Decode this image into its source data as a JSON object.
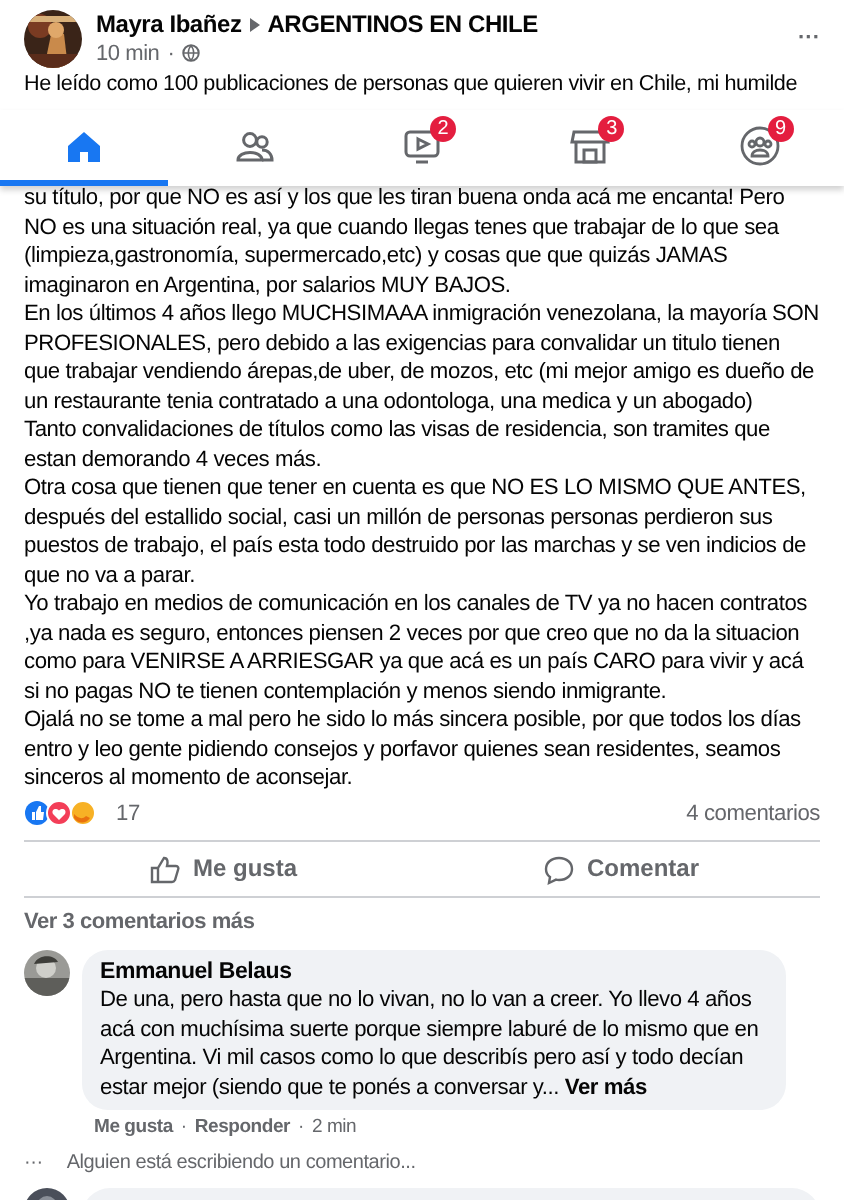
{
  "post": {
    "author": "Mayra Ibañez",
    "group": "ARGENTINOS EN CHILE",
    "time": "10 min",
    "time_separator": "·",
    "more": "···",
    "first_line": "He leído como 100 publicaciones de personas que quieren vivir en Chile, mi humilde",
    "paragraphs": [
      "su título, por que NO es así y los que les tiran buena onda acá me encanta!  Pero NO es una situación real, ya que cuando llegas tenes que trabajar de lo que sea (limpieza,gastronomía, supermercado,etc) y cosas que que quizás JAMAS imaginaron en Argentina, por salarios MUY BAJOS.",
      "En los últimos 4 años llego MUCHSIMAAA inmigración  venezolana, la mayoría SON PROFESIONALES, pero debido a las exigencias para convalidar un titulo tienen que trabajar vendiendo árepas,de uber, de mozos, etc (mi mejor amigo es dueño de un restaurante tenia contratado a una odontologa, una medica y un abogado)",
      "Tanto convalidaciones de títulos como las visas de residencia, son tramites que estan demorando 4 veces más.",
      "Otra cosa que tienen que tener en cuenta es que NO ES LO MISMO QUE ANTES, después del estallido social, casi un millón de personas personas perdieron sus puestos de trabajo, el país esta todo destruido por las marchas y se ven  indicios de que no va a parar.",
      "Yo trabajo en medios de comunicación en los canales de TV ya no hacen contratos ,ya nada es seguro, entonces piensen 2 veces por que creo que no da la situacion como para VENIRSE A ARRIESGAR ya que acá es un país CARO para vivir y acá si no pagas NO te tienen contemplación y menos siendo inmigrante.",
      "Ojalá no se tome a mal pero he sido lo más sincera posible, por que todos los días entro y leo gente pidiendo consejos y porfavor quienes sean residentes, seamos sinceros al momento de aconsejar."
    ],
    "reaction_count": "17",
    "comments_count": "4 comentarios",
    "actions": [
      {
        "kind": "like",
        "label": "Me gusta"
      },
      {
        "kind": "comment",
        "label": "Comentar"
      }
    ]
  },
  "nav": [
    {
      "kind": "home",
      "selected": true
    },
    {
      "kind": "friends",
      "selected": false
    },
    {
      "kind": "watch",
      "selected": false,
      "badge": "2"
    },
    {
      "kind": "marketplace",
      "selected": false,
      "badge": "3"
    },
    {
      "kind": "groups",
      "selected": false,
      "badge": "9"
    }
  ],
  "more_comments": "Ver 3 comentarios más",
  "comment": {
    "author": "Emmanuel Belaus",
    "text": "De una, pero hasta que no lo vivan, no lo van a creer. Yo llevo 4 años acá con muchísima suerte porque siempre laburé de lo mismo que en Argentina. Vi mil casos como lo que describís pero así y todo decían estar mejor (siendo que te ponés a conversar y...",
    "see_more": "Ver más",
    "separator": "·",
    "like": "Me gusta",
    "reply": "Responder",
    "time": "2 min"
  },
  "typing": {
    "dots": "···",
    "text": "Alguien está escribiendo un comentario..."
  }
}
